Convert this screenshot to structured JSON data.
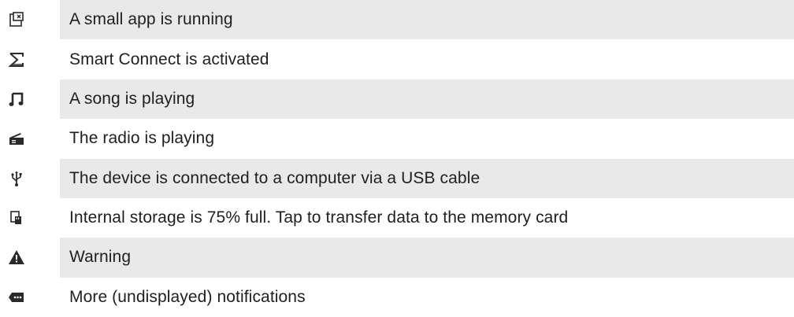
{
  "rows": [
    {
      "icon": "small-app-icon",
      "label": "A small app is running"
    },
    {
      "icon": "smart-connect-icon",
      "label": "Smart Connect is activated"
    },
    {
      "icon": "music-note-icon",
      "label": "A song is playing"
    },
    {
      "icon": "radio-icon",
      "label": "The radio is playing"
    },
    {
      "icon": "usb-icon",
      "label": "The device is connected to a computer via a USB cable"
    },
    {
      "icon": "storage-transfer-icon",
      "label": "Internal storage is 75% full. Tap to transfer data to the memory card"
    },
    {
      "icon": "warning-icon",
      "label": "Warning"
    },
    {
      "icon": "more-notifications-icon",
      "label": "More (undisplayed) notifications"
    }
  ]
}
